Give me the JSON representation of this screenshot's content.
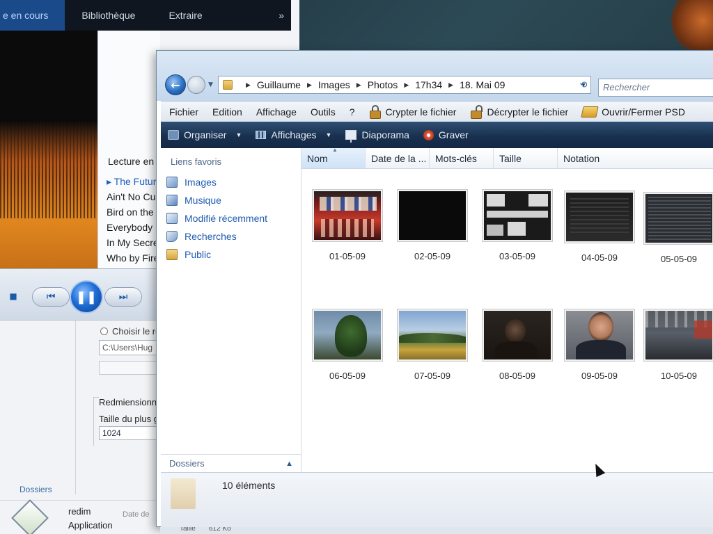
{
  "media_player": {
    "tabs": [
      {
        "label": "e en cours"
      },
      {
        "label": "Bibliothèque"
      },
      {
        "label": "Extraire"
      }
    ],
    "more_label": "»",
    "playlist_header": "Lecture en c",
    "playlist": [
      {
        "title": "The Future",
        "current": true
      },
      {
        "title": "Ain't No Cu",
        "current": false
      },
      {
        "title": "Bird on the",
        "current": false
      },
      {
        "title": "Everybody K",
        "current": false
      },
      {
        "title": "In My Secre",
        "current": false
      },
      {
        "title": "Who by Fire",
        "current": false
      }
    ],
    "controls": {
      "stop_glyph": "■",
      "prev_glyph": "⏮",
      "pause_glyph": "❚❚",
      "next_glyph": "⏭"
    }
  },
  "resize_dialog": {
    "radio_label": "Choisir le ré",
    "path_value": "C:\\Users\\Hug",
    "resize_label": "Redmiensionne",
    "size_label": "Taille du plus g",
    "size_value": "1024",
    "folders_link": "Dossiers",
    "app_name": "redim",
    "app_type": "Application",
    "date_label": "Date de",
    "size_footer_label": "Taille",
    "size_footer_value": "612 Ko"
  },
  "explorer": {
    "address": {
      "breadcrumbs": [
        "Guillaume",
        "Images",
        "Photos",
        "17h34",
        "18. Mai 09"
      ]
    },
    "search_placeholder": "Rechercher",
    "menu": {
      "items": [
        "Fichier",
        "Edition",
        "Affichage",
        "Outils",
        "?"
      ],
      "encrypt_label": "Crypter le fichier",
      "decrypt_label": "Décrypter le fichier",
      "psd_label": "Ouvrir/Fermer PSD"
    },
    "commands": {
      "organize": "Organiser",
      "views": "Affichages",
      "slideshow": "Diaporama",
      "burn": "Graver"
    },
    "sidebar": {
      "title": "Liens favoris",
      "items": [
        {
          "label": "Images",
          "icon": "pictures-icon"
        },
        {
          "label": "Musique",
          "icon": "music-icon"
        },
        {
          "label": "Modifié récemment",
          "icon": "recent-icon"
        },
        {
          "label": "Recherches",
          "icon": "searches-icon"
        },
        {
          "label": "Public",
          "icon": "public-folder-icon"
        }
      ],
      "folders_label": "Dossiers"
    },
    "columns": [
      "Nom",
      "Date de la ...",
      "Mots-clés",
      "Taille",
      "Notation"
    ],
    "files": [
      {
        "name": "01-05-09"
      },
      {
        "name": "02-05-09"
      },
      {
        "name": "03-05-09"
      },
      {
        "name": "04-05-09"
      },
      {
        "name": "05-05-09"
      },
      {
        "name": "06-05-09"
      },
      {
        "name": "07-05-09"
      },
      {
        "name": "08-05-09"
      },
      {
        "name": "09-05-09"
      },
      {
        "name": "10-05-09"
      }
    ],
    "details": {
      "count_label": "10 éléments"
    }
  },
  "colors": {
    "accent": "#1f5bb0",
    "command_bar": "#19314f",
    "player_active_tab": "#1b4a8a"
  }
}
